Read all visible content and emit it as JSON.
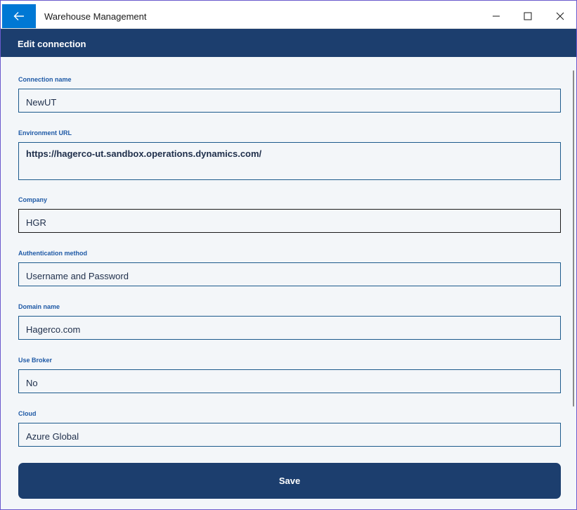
{
  "window": {
    "title": "Warehouse Management"
  },
  "icons": {
    "back": "back-arrow-icon",
    "minimize": "minimize-icon",
    "maximize": "maximize-icon",
    "close": "close-icon"
  },
  "header": {
    "title": "Edit connection"
  },
  "fields": [
    {
      "label": "Connection name",
      "value": "NewUT"
    },
    {
      "label": "Environment URL",
      "value": "https://hagerco-ut.sandbox.operations.dynamics.com/"
    },
    {
      "label": "Company",
      "value": "HGR"
    },
    {
      "label": "Authentication method",
      "value": "Username and Password"
    },
    {
      "label": "Domain name",
      "value": "Hagerco.com"
    },
    {
      "label": "Use Broker",
      "value": "No"
    },
    {
      "label": "Cloud",
      "value": "Azure Global"
    }
  ],
  "actions": {
    "save_label": "Save"
  },
  "colors": {
    "accent": "#0078d4",
    "header_bg": "#1c3e6e",
    "field_border": "#1c5a8c",
    "label": "#1f5aa6",
    "background": "#f3f6f9"
  }
}
